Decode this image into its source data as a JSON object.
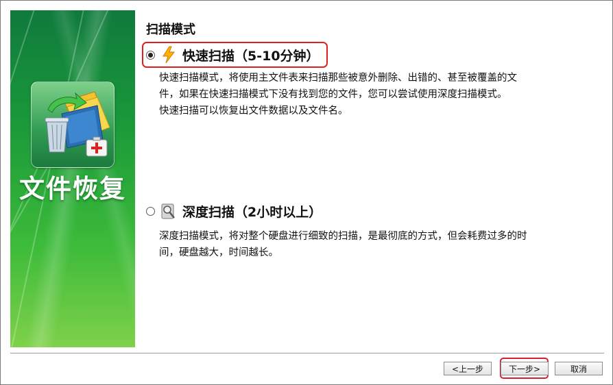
{
  "banner": {
    "title": "文件恢复",
    "icon": "file-recovery-icon",
    "colors": {
      "top": "#0f7a3c",
      "bottom": "#7fd14a"
    }
  },
  "section": {
    "title": "扫描模式"
  },
  "options": [
    {
      "id": "quick",
      "selected": true,
      "icon": "lightning-icon",
      "label": "快速扫描（5-10分钟）",
      "description": [
        "快速扫描模式，将使用主文件表来扫描那些被意外删除、出错的、甚至被覆盖的文",
        "件，如果在快速扫描模式下没有找到您的文件，您可以尝试使用深度扫描模式。",
        "快速扫描可以恢复出文件数据以及文件名。"
      ]
    },
    {
      "id": "deep",
      "selected": false,
      "icon": "disk-magnifier-icon",
      "label": "深度扫描（2小时以上）",
      "description": [
        "深度扫描模式，将对整个硬盘进行细致的扫描，是最彻底的方式，但会耗费过多的时",
        "间，硬盘越大，时间越长。"
      ]
    }
  ],
  "buttons": {
    "prev": "<上一步",
    "next": "下一步>",
    "cancel": "取消"
  },
  "highlight_color": "#e02020"
}
